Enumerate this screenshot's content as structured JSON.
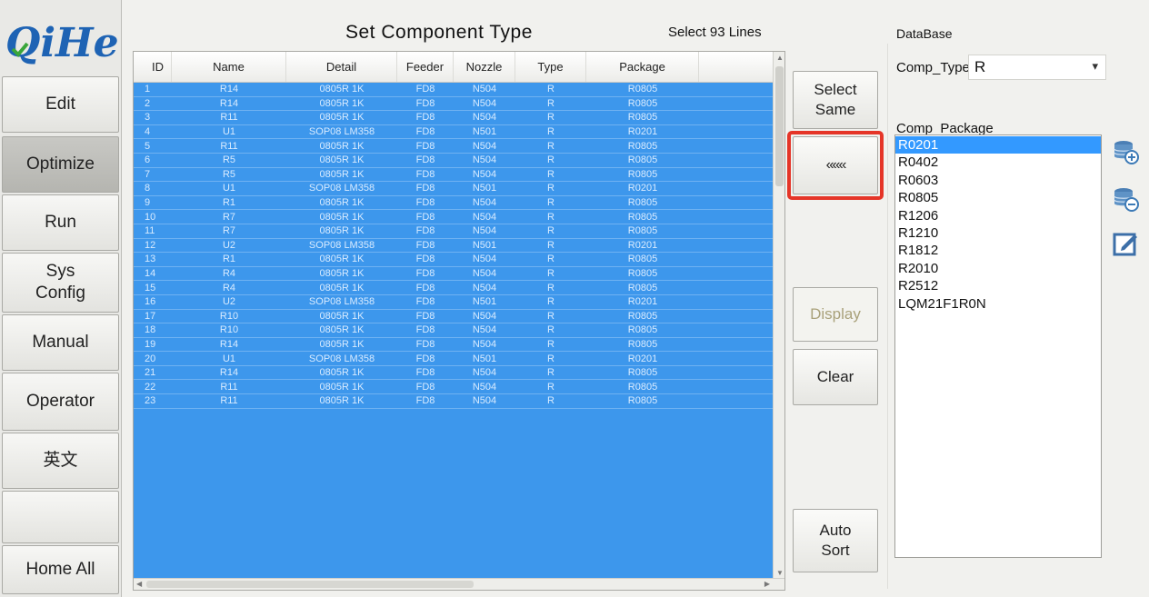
{
  "app": {
    "logo_text": "QiHe"
  },
  "sidebar": {
    "items": [
      {
        "label": "Edit",
        "active": false
      },
      {
        "label": "Optimize",
        "active": true
      },
      {
        "label": "Run",
        "active": false
      },
      {
        "label": "Sys\nConfig",
        "active": false
      },
      {
        "label": "Manual",
        "active": false
      },
      {
        "label": "Operator",
        "active": false
      },
      {
        "label": "英文",
        "active": false
      },
      {
        "label": "",
        "active": false
      },
      {
        "label": "Home All",
        "active": false
      }
    ]
  },
  "main": {
    "title": "Set  Component  Type",
    "select_count": "Select 93 Lines"
  },
  "table": {
    "columns": [
      "ID",
      "Name",
      "Detail",
      "Feeder",
      "Nozzle",
      "Type",
      "Package"
    ],
    "rows": [
      [
        "1",
        "R14",
        "0805R 1K",
        "FD8",
        "N504",
        "R",
        "R0805"
      ],
      [
        "2",
        "R14",
        "0805R 1K",
        "FD8",
        "N504",
        "R",
        "R0805"
      ],
      [
        "3",
        "R11",
        "0805R 1K",
        "FD8",
        "N504",
        "R",
        "R0805"
      ],
      [
        "4",
        "U1",
        "SOP08 LM358",
        "FD8",
        "N501",
        "R",
        "R0201"
      ],
      [
        "5",
        "R11",
        "0805R 1K",
        "FD8",
        "N504",
        "R",
        "R0805"
      ],
      [
        "6",
        "R5",
        "0805R 1K",
        "FD8",
        "N504",
        "R",
        "R0805"
      ],
      [
        "7",
        "R5",
        "0805R 1K",
        "FD8",
        "N504",
        "R",
        "R0805"
      ],
      [
        "8",
        "U1",
        "SOP08 LM358",
        "FD8",
        "N501",
        "R",
        "R0201"
      ],
      [
        "9",
        "R1",
        "0805R 1K",
        "FD8",
        "N504",
        "R",
        "R0805"
      ],
      [
        "10",
        "R7",
        "0805R 1K",
        "FD8",
        "N504",
        "R",
        "R0805"
      ],
      [
        "11",
        "R7",
        "0805R 1K",
        "FD8",
        "N504",
        "R",
        "R0805"
      ],
      [
        "12",
        "U2",
        "SOP08 LM358",
        "FD8",
        "N501",
        "R",
        "R0201"
      ],
      [
        "13",
        "R1",
        "0805R 1K",
        "FD8",
        "N504",
        "R",
        "R0805"
      ],
      [
        "14",
        "R4",
        "0805R 1K",
        "FD8",
        "N504",
        "R",
        "R0805"
      ],
      [
        "15",
        "R4",
        "0805R 1K",
        "FD8",
        "N504",
        "R",
        "R0805"
      ],
      [
        "16",
        "U2",
        "SOP08 LM358",
        "FD8",
        "N501",
        "R",
        "R0201"
      ],
      [
        "17",
        "R10",
        "0805R 1K",
        "FD8",
        "N504",
        "R",
        "R0805"
      ],
      [
        "18",
        "R10",
        "0805R 1K",
        "FD8",
        "N504",
        "R",
        "R0805"
      ],
      [
        "19",
        "R14",
        "0805R 1K",
        "FD8",
        "N504",
        "R",
        "R0805"
      ],
      [
        "20",
        "U1",
        "SOP08 LM358",
        "FD8",
        "N501",
        "R",
        "R0201"
      ],
      [
        "21",
        "R14",
        "0805R 1K",
        "FD8",
        "N504",
        "R",
        "R0805"
      ],
      [
        "22",
        "R11",
        "0805R 1K",
        "FD8",
        "N504",
        "R",
        "R0805"
      ],
      [
        "23",
        "R11",
        "0805R 1K",
        "FD8",
        "N504",
        "R",
        "R0805"
      ]
    ]
  },
  "actions": {
    "select_same": "Select\nSame",
    "move_left": "«««",
    "display": "Display",
    "clear": "Clear",
    "auto_sort": "Auto\nSort"
  },
  "database": {
    "title": "DataBase",
    "comp_type_label": "Comp_Type",
    "comp_type_value": "R",
    "comp_package_label": "Comp_Package",
    "packages": [
      "R0201",
      "R0402",
      "R0603",
      "R0805",
      "R1206",
      "R1210",
      "R1812",
      "R2010",
      "R2512",
      "LQM21F1R0N"
    ],
    "selected_package": "R0201"
  },
  "colors": {
    "selection": "#3d97ec",
    "highlight_border": "#e53528",
    "logo_blue": "#1e63b4",
    "logo_green": "#3aa63a"
  }
}
